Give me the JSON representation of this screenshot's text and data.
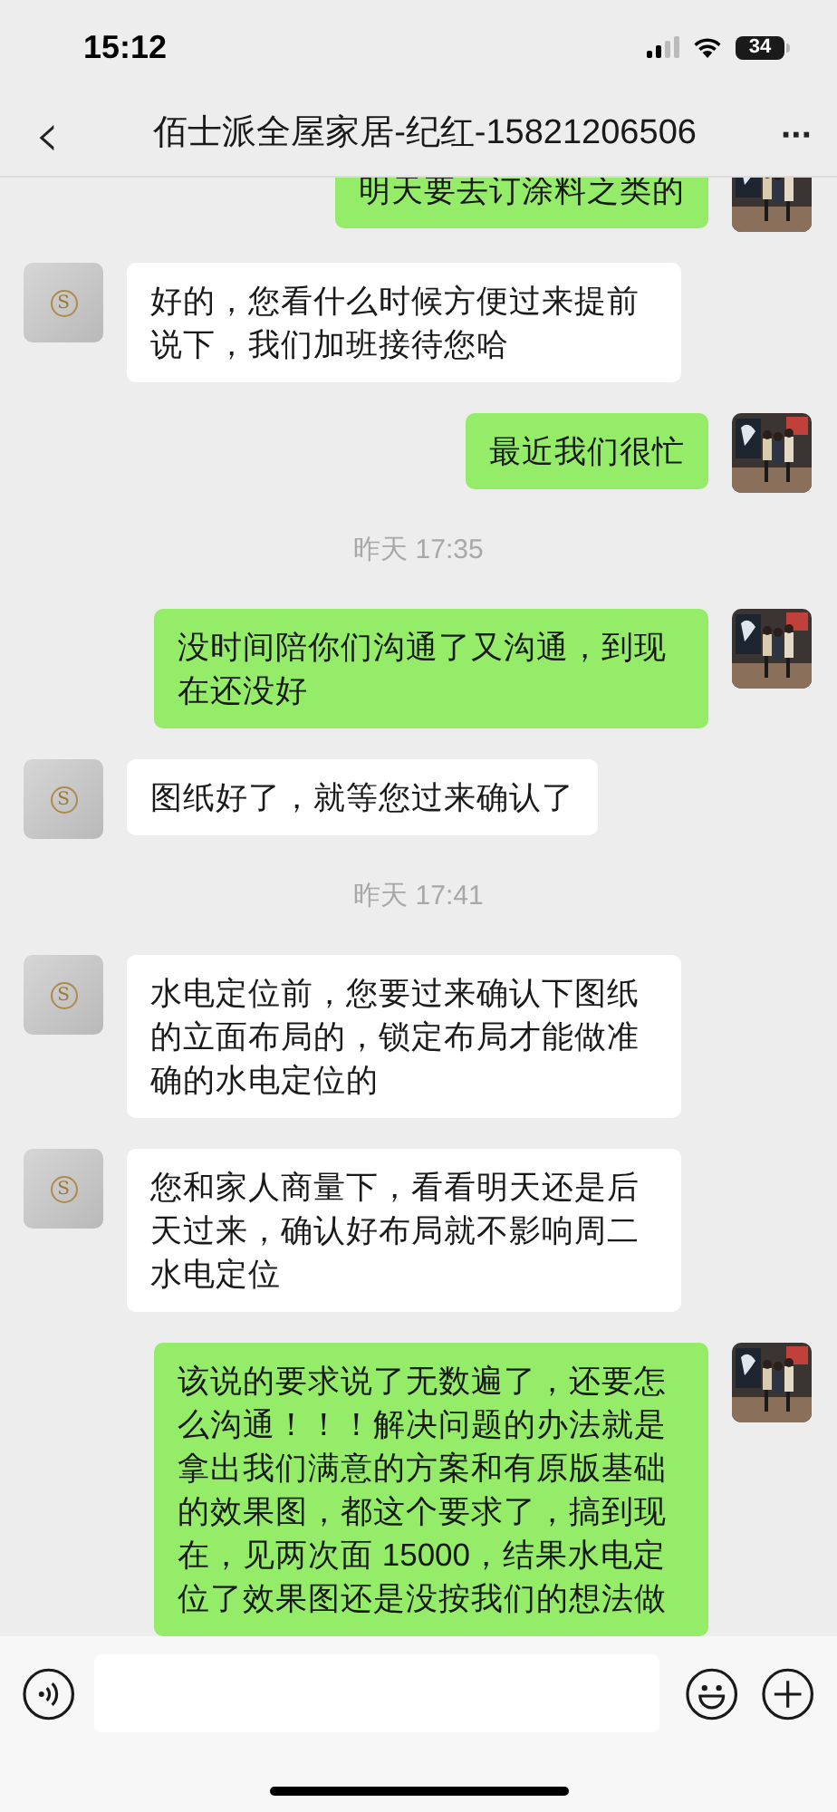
{
  "status_bar": {
    "time": "15:12",
    "battery": "34"
  },
  "header": {
    "back": "‹",
    "title": "佰士派全屋家居-纪红-15821206506",
    "more": "···"
  },
  "messages": [
    {
      "kind": "me",
      "text": "明天要去订涂料之类的"
    },
    {
      "kind": "them",
      "text": "好的，您看什么时候方便过来提前说下，我们加班接待您哈",
      "avatar_letter": "S"
    },
    {
      "kind": "me",
      "text": "最近我们很忙"
    },
    {
      "kind": "time",
      "text": "昨天 17:35"
    },
    {
      "kind": "me",
      "text": "没时间陪你们沟通了又沟通，到现在还没好"
    },
    {
      "kind": "them",
      "text": "图纸好了，就等您过来确认了",
      "avatar_letter": "S"
    },
    {
      "kind": "time",
      "text": "昨天 17:41"
    },
    {
      "kind": "them",
      "text": "水电定位前，您要过来确认下图纸的立面布局的，锁定布局才能做准确的水电定位的",
      "avatar_letter": "S"
    },
    {
      "kind": "them",
      "text": "您和家人商量下，看看明天还是后天过来，确认好布局就不影响周二水电定位",
      "avatar_letter": "S"
    },
    {
      "kind": "me",
      "text": "该说的要求说了无数遍了，还要怎么沟通！！！解决问题的办法就是拿出我们满意的方案和有原版基础的效果图，都这个要求了，搞到现在，见两次面 15000，结果水电定位了效果图还是没按我们的想法做"
    }
  ]
}
